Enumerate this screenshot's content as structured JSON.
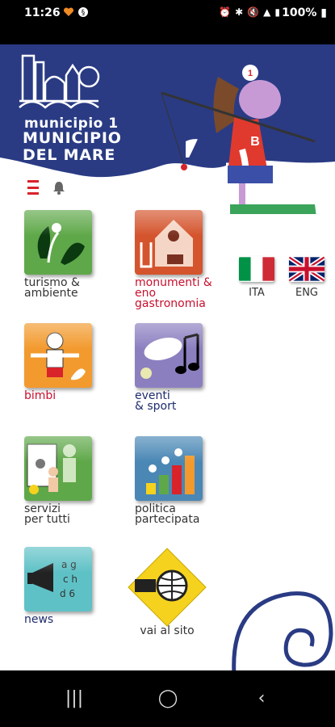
{
  "status_bar": {
    "time": "11:26",
    "battery": "100%",
    "left_icons": [
      "heart-icon",
      "settings-circle-icon"
    ],
    "right_icons": [
      "alarm-icon",
      "bluetooth-icon",
      "mute-icon",
      "signal-icon",
      "wifi-icon"
    ]
  },
  "header": {
    "line1": "municipio 1",
    "line2": "MUNICIPIO DEL MARE",
    "mascot_number": "1",
    "mascot_shirt_letter": "B",
    "colors": {
      "banner": "#2a3b84",
      "accent": "#d9222a"
    }
  },
  "toolbar": {
    "menu_icon": "menu-icon",
    "bell_icon": "bell-icon"
  },
  "tiles": [
    {
      "id": "turismo",
      "label": "turismo & ambiente",
      "color": "#5fa84a"
    },
    {
      "id": "monumenti",
      "label": "monumenti & eno gastronomia",
      "color": "#d4542d"
    },
    {
      "id": "bimbi",
      "label": "bimbi",
      "color": "#f29a2e"
    },
    {
      "id": "eventi",
      "label": "eventi & sport",
      "color": "#8c7fc0"
    },
    {
      "id": "servizi",
      "label": "servizi per tutti",
      "color": "#5fa84a"
    },
    {
      "id": "politica",
      "label": "politica partecipata",
      "color": "#4a87b5"
    },
    {
      "id": "news",
      "label": "news",
      "color": "#5ec1c6"
    },
    {
      "id": "sito",
      "label": "vai al sito",
      "color": "#f5d21e"
    }
  ],
  "languages": [
    {
      "code": "ITA"
    },
    {
      "code": "ENG"
    }
  ],
  "nav": {
    "recent": "recent-apps-icon",
    "home": "home-icon",
    "back": "back-icon"
  }
}
